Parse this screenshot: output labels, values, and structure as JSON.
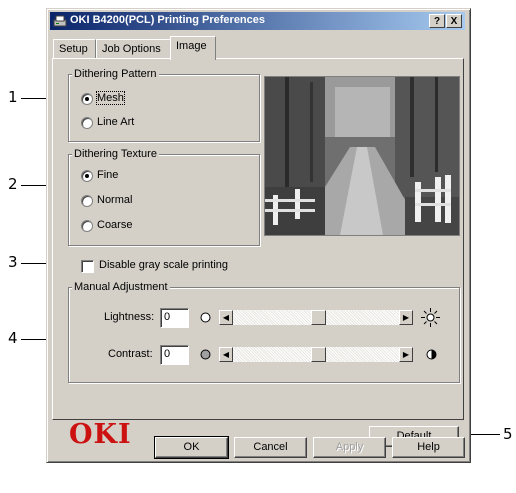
{
  "window": {
    "title": "OKI B4200(PCL) Printing Preferences",
    "help_btn": "?",
    "close_btn": "X"
  },
  "tabs": [
    {
      "label": "Setup",
      "active": false
    },
    {
      "label": "Job Options",
      "active": false
    },
    {
      "label": "Image",
      "active": true
    }
  ],
  "dithering_pattern": {
    "label": "Dithering Pattern",
    "options": [
      {
        "label": "Mesh",
        "selected": true
      },
      {
        "label": "Line Art",
        "selected": false
      }
    ]
  },
  "dithering_texture": {
    "label": "Dithering Texture",
    "options": [
      {
        "label": "Fine",
        "selected": true
      },
      {
        "label": "Normal",
        "selected": false
      },
      {
        "label": "Coarse",
        "selected": false
      }
    ]
  },
  "grayscale": {
    "label": "Disable gray scale printing",
    "checked": false
  },
  "manual_adjustment": {
    "label": "Manual Adjustment",
    "lightness": {
      "label": "Lightness:",
      "value": "0"
    },
    "contrast": {
      "label": "Contrast:",
      "value": "0"
    }
  },
  "brand": {
    "logo_text": "OKI",
    "color": "#cc1111"
  },
  "buttons": {
    "default": "Default",
    "ok": "OK",
    "cancel": "Cancel",
    "apply": "Apply",
    "help": "Help"
  },
  "callouts": [
    "1",
    "2",
    "3",
    "4",
    "5"
  ],
  "colors": {
    "titlebar_start": "#0a246a",
    "titlebar_end": "#a6caf0",
    "face": "#d4d0c8"
  }
}
